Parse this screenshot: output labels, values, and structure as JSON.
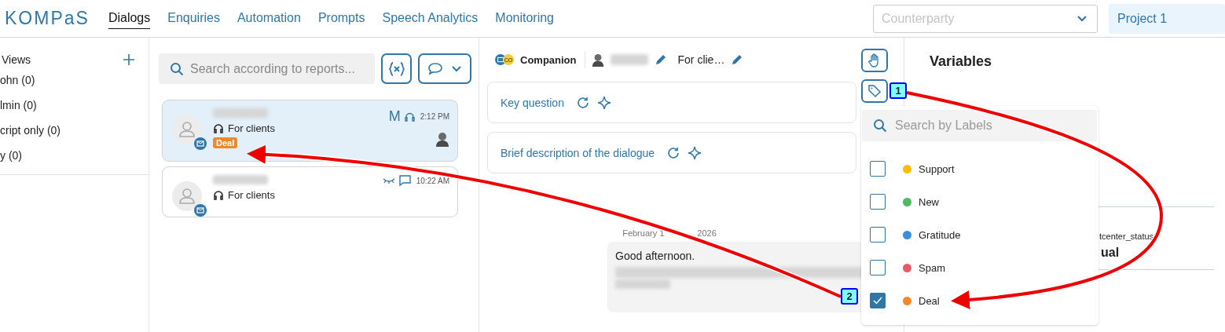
{
  "logo": "KOMPaS",
  "nav": [
    {
      "label": "Dialogs",
      "selected": true
    },
    {
      "label": "Enquiries",
      "selected": false
    },
    {
      "label": "Automation",
      "selected": false
    },
    {
      "label": "Prompts",
      "selected": false
    },
    {
      "label": "Speech Analytics",
      "selected": false
    },
    {
      "label": "Monitoring",
      "selected": false
    }
  ],
  "counterparty": {
    "placeholder": "Counterparty"
  },
  "project": "Project 1",
  "sidebar": {
    "title": "Views",
    "items": [
      "ohn (0)",
      "lmin (0)",
      "cript only (0)",
      "y (0)"
    ]
  },
  "search": {
    "placeholder": "Search according to reports..."
  },
  "dialogs": [
    {
      "status_letter": "M",
      "kind": "assigned",
      "time": "2:12 PM",
      "topic": "For clients",
      "tag": {
        "label": "Deal",
        "color": "#f0892a"
      },
      "selected": true
    },
    {
      "kind": "unread",
      "time": "10:22 AM",
      "topic": "For clients",
      "selected": false
    }
  ],
  "chat": {
    "channel_badge": "CO",
    "contact": "Companion",
    "topic": "For clie…",
    "summary_cards": [
      "Key question",
      "Brief description of the dialogue"
    ],
    "date_parts": [
      "February 1",
      "2026"
    ],
    "message": "Good afternoon."
  },
  "variables": {
    "title": "Variables",
    "name": "tcenter_status",
    "value": "ual"
  },
  "labels_popup": {
    "placeholder": "Search by Labels",
    "labels": [
      {
        "name": "Support",
        "color": "#fbbd08",
        "checked": false
      },
      {
        "name": "New",
        "color": "#4cbb63",
        "checked": false
      },
      {
        "name": "Gratitude",
        "color": "#3b8de0",
        "checked": false
      },
      {
        "name": "Spam",
        "color": "#e85a66",
        "checked": false
      },
      {
        "name": "Deal",
        "color": "#f0892a",
        "checked": true
      }
    ]
  },
  "annotations": [
    {
      "number": "1"
    },
    {
      "number": "2"
    }
  ]
}
